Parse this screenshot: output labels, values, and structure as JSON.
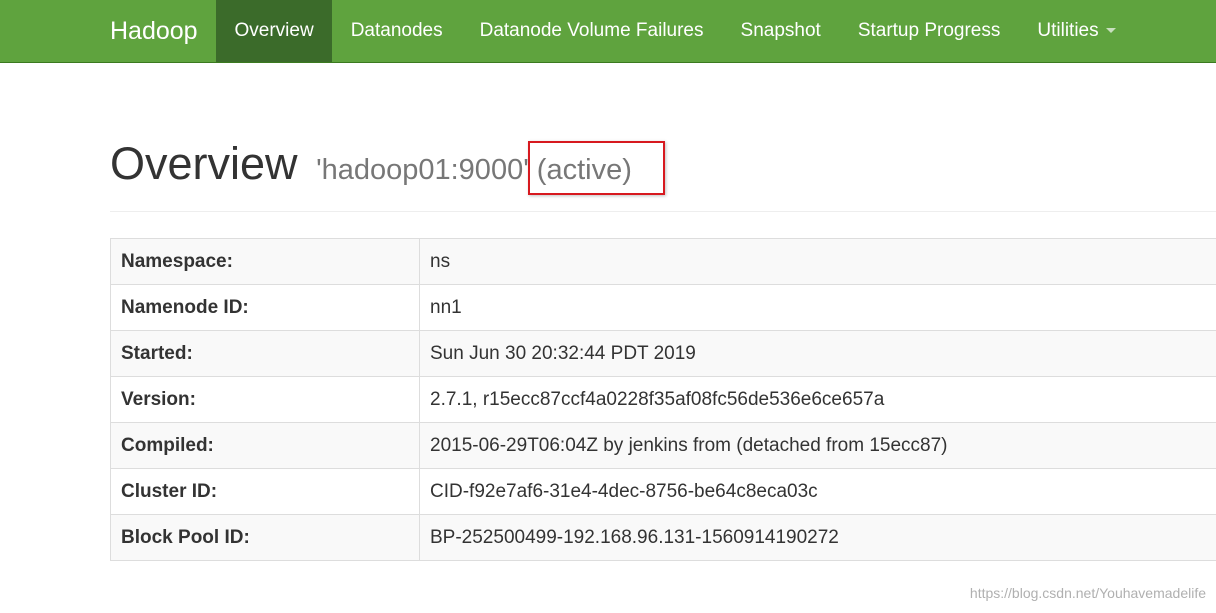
{
  "navbar": {
    "brand": "Hadoop",
    "items": [
      {
        "label": "Overview",
        "active": true
      },
      {
        "label": "Datanodes",
        "active": false
      },
      {
        "label": "Datanode Volume Failures",
        "active": false
      },
      {
        "label": "Snapshot",
        "active": false
      },
      {
        "label": "Startup Progress",
        "active": false
      },
      {
        "label": "Utilities",
        "active": false,
        "dropdown": true
      }
    ],
    "background_color": "#5fa33e",
    "active_color": "#3b6b2a"
  },
  "header": {
    "title": "Overview",
    "host": "'hadoop01:9000'",
    "state": "(active)",
    "highlight_color": "#d7191f"
  },
  "overview_table": {
    "rows": [
      {
        "label": "Namespace:",
        "value": "ns"
      },
      {
        "label": "Namenode ID:",
        "value": "nn1"
      },
      {
        "label": "Started:",
        "value": "Sun Jun 30 20:32:44 PDT 2019"
      },
      {
        "label": "Version:",
        "value": "2.7.1, r15ecc87ccf4a0228f35af08fc56de536e6ce657a"
      },
      {
        "label": "Compiled:",
        "value": "2015-06-29T06:04Z by jenkins from (detached from 15ecc87)"
      },
      {
        "label": "Cluster ID:",
        "value": "CID-f92e7af6-31e4-4dec-8756-be64c8eca03c"
      },
      {
        "label": "Block Pool ID:",
        "value": "BP-252500499-192.168.96.131-1560914190272"
      }
    ]
  },
  "watermark": "https://blog.csdn.net/Youhavemadelife"
}
